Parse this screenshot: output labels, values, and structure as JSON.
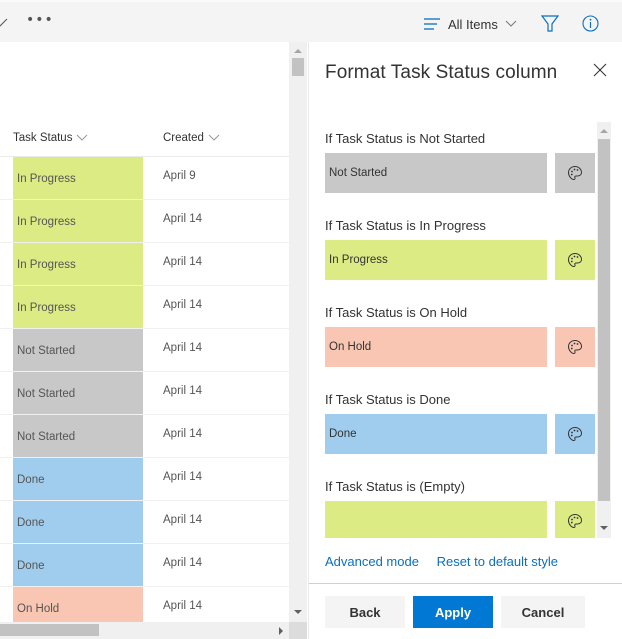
{
  "toolbar": {
    "more_label": "•••",
    "view_label": "All Items",
    "icons": {
      "view": "view-list-icon",
      "filter": "filter-icon",
      "info": "info-icon"
    }
  },
  "list": {
    "columns": [
      {
        "label": "Task Status"
      },
      {
        "label": "Created"
      }
    ],
    "rows": [
      {
        "status": "In Progress",
        "created": "April 9"
      },
      {
        "status": "In Progress",
        "created": "April 14"
      },
      {
        "status": "In Progress",
        "created": "April 14"
      },
      {
        "status": "In Progress",
        "created": "April 14"
      },
      {
        "status": "Not Started",
        "created": "April 14"
      },
      {
        "status": "Not Started",
        "created": "April 14"
      },
      {
        "status": "Not Started",
        "created": "April 14"
      },
      {
        "status": "Done",
        "created": "April 14"
      },
      {
        "status": "Done",
        "created": "April 14"
      },
      {
        "status": "Done",
        "created": "April 14"
      },
      {
        "status": "On Hold",
        "created": "April 14"
      }
    ]
  },
  "status_colors": {
    "Not Started": "#c8c8c8",
    "In Progress": "#ddeb85",
    "On Hold": "#f8c6b2",
    "Done": "#a0cdee",
    "(Empty)": "#ddeb85"
  },
  "panel": {
    "title": "Format Task Status column",
    "rules": [
      {
        "label": "If Task Status is Not Started",
        "value": "Not Started",
        "key": "Not Started"
      },
      {
        "label": "If Task Status is In Progress",
        "value": "In Progress",
        "key": "In Progress"
      },
      {
        "label": "If Task Status is On Hold",
        "value": "On Hold",
        "key": "On Hold"
      },
      {
        "label": "If Task Status is Done",
        "value": "Done",
        "key": "Done"
      },
      {
        "label": "If Task Status is (Empty)",
        "value": "",
        "key": "(Empty)"
      }
    ],
    "links": {
      "advanced": "Advanced mode",
      "reset": "Reset to default style"
    },
    "buttons": {
      "back": "Back",
      "apply": "Apply",
      "cancel": "Cancel"
    }
  }
}
